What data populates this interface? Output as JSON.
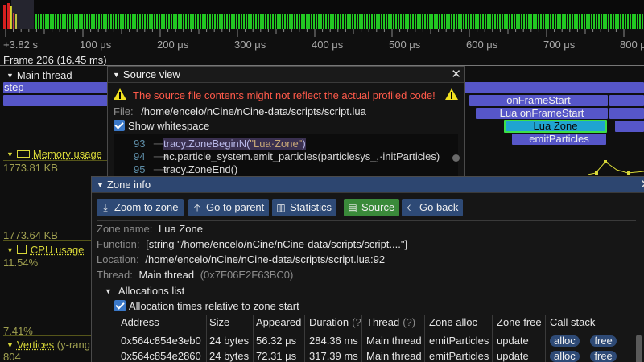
{
  "ruler": {
    "ticks": [
      {
        "label": "+3.82 s"
      },
      {
        "label": "100 μs"
      },
      {
        "label": "200 μs"
      },
      {
        "label": "300 μs"
      },
      {
        "label": "400 μs"
      },
      {
        "label": "500 μs"
      },
      {
        "label": "600 μs"
      },
      {
        "label": "700 μs"
      },
      {
        "label": "800 μ"
      }
    ]
  },
  "timeline": {
    "frame_label": "Frame 206 (16.45 ms)",
    "main_thread": "Main thread",
    "zones": {
      "step": "step",
      "on_frame_start": "onFrameStart",
      "lua_on_frame_start": "Lua onFrameStart",
      "lua_zone": "Lua Zone",
      "emit_particles": "emitParticles"
    },
    "memory_usage": {
      "label": "Memory usage",
      "value_top": "1773.81 KB",
      "value_bottom": "1773.64 KB"
    },
    "cpu_usage": {
      "label": "CPU usage",
      "value_top": "11.54%",
      "value_bottom": "7.41%"
    },
    "vertices": {
      "label": "Vertices",
      "extra": "(y-rang",
      "value": "804"
    }
  },
  "source_view": {
    "title": "Source view",
    "warning": "The source file contents might not reflect the actual profiled code!",
    "file_key": "File:",
    "file_path": "/home/encelo/nCine/nCine-data/scripts/script.lua",
    "show_whitespace": "Show whitespace",
    "lines": [
      {
        "num": "93",
        "pre": "tracy.ZoneBeginN(",
        "str": "\"Lua·Zone\"",
        "post": ")"
      },
      {
        "num": "94",
        "pre": "nc.particle_system.emit_particles(particlesys_,·initParticles)",
        "str": "",
        "post": ""
      },
      {
        "num": "95",
        "pre": "tracy.ZoneEnd()",
        "str": "",
        "post": ""
      }
    ]
  },
  "zone_info": {
    "title": "Zone info",
    "buttons": {
      "zoom": "Zoom to zone",
      "parent": "Go to parent",
      "stats": "Statistics",
      "source": "Source",
      "back": "Go back"
    },
    "zone_name_key": "Zone name:",
    "zone_name": "Lua Zone",
    "function_key": "Function:",
    "function": "[string \"/home/encelo/nCine/nCine-data/scripts/script....\"]",
    "location_key": "Location:",
    "location": "/home/encelo/nCine/nCine-data/scripts/script.lua:92",
    "thread_key": "Thread:",
    "thread": "Main thread",
    "thread_id": "(0x7F06E2F63BC0)",
    "alloc_header": "Allocations list",
    "alloc_relative": "Allocation times relative to zone start",
    "table": {
      "headers": {
        "address": "Address",
        "size": "Size",
        "appeared": "Appeared",
        "duration": "Duration",
        "thread": "Thread",
        "zone_alloc": "Zone alloc",
        "zone_free": "Zone free",
        "call_stack": "Call stack"
      },
      "q": "(?)",
      "rows": [
        {
          "address": "0x564c854e3eb0",
          "size": "24 bytes",
          "appeared": "56.32 μs",
          "duration": "284.36 ms",
          "thread": "Main thread",
          "zone_alloc": "emitParticles",
          "zone_free": "update",
          "alloc": "alloc",
          "free": "free"
        },
        {
          "address": "0x564c854e2860",
          "size": "24 bytes",
          "appeared": "72.31 μs",
          "duration": "317.39 ms",
          "thread": "Main thread",
          "zone_alloc": "emitParticles",
          "zone_free": "update",
          "alloc": "alloc",
          "free": "free"
        }
      ]
    }
  },
  "colors": {
    "frame_green": "#22c822",
    "frame_red": "#d82020",
    "frame_yellow": "#d8d820",
    "zone_blue": "#5656c8",
    "selected_zone": "#1fa4d0",
    "highlight": "#3ce048",
    "warning_red": "#ff5a4a",
    "plot_yellow": "#d8d838"
  }
}
